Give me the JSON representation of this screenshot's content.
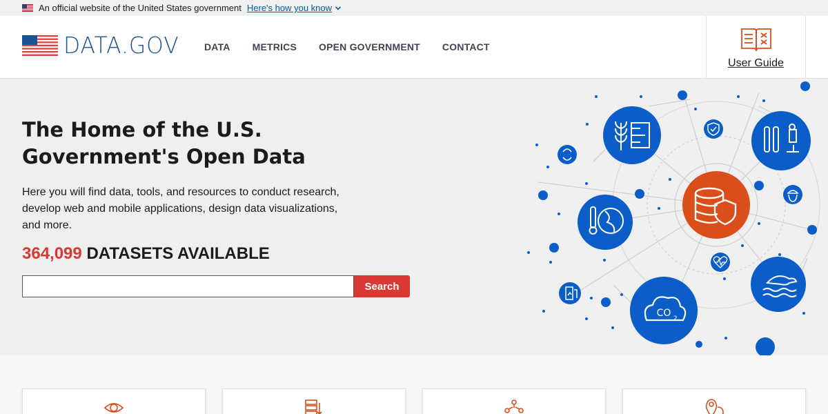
{
  "banner": {
    "official_text": "An official website of the United States government",
    "how_know_link": "Here's how you know"
  },
  "header": {
    "logo_text": "DATA.GOV",
    "nav": [
      {
        "label": "DATA"
      },
      {
        "label": "METRICS"
      },
      {
        "label": "OPEN GOVERNMENT"
      },
      {
        "label": "CONTACT"
      }
    ],
    "user_guide_label": "User Guide"
  },
  "hero": {
    "title": "The Home of the U.S. Government's Open Data",
    "intro": "Here you will find data, tools, and resources to conduct research, develop web and mobile applications, design data visualizations, and more.",
    "dataset_count": "364,099",
    "dataset_suffix": "DATASETS AVAILABLE",
    "search_value": "",
    "search_button": "Search"
  },
  "cards": [
    {
      "icon": "eye-icon"
    },
    {
      "icon": "server-arrow-icon"
    },
    {
      "icon": "network-people-icon"
    },
    {
      "icon": "map-pin-icon"
    }
  ],
  "colors": {
    "accent_red": "#d83933",
    "brand_blue": "#1a5394",
    "link_blue": "#005ea2",
    "illustration_blue": "#0b5dc8",
    "illustration_orange": "#d94e1a"
  }
}
